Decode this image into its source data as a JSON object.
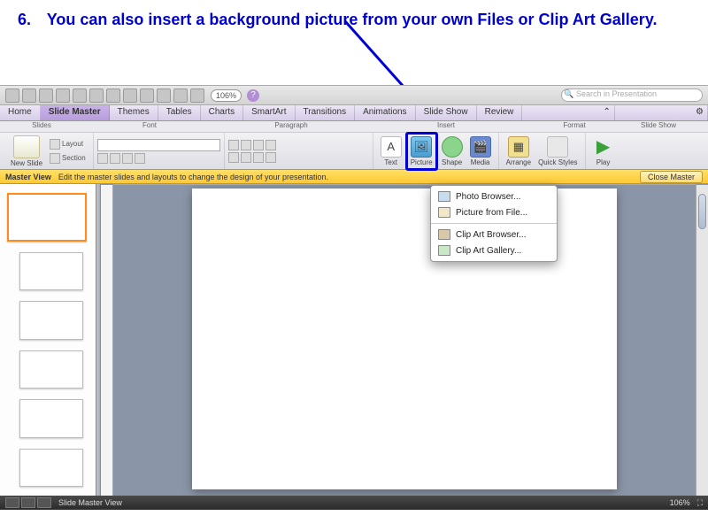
{
  "instruction": {
    "number": "6.",
    "text": "You can also insert a background picture from your own Files or Clip Art Gallery."
  },
  "qat": {
    "zoom": "106%",
    "search_placeholder": "Search in Presentation"
  },
  "tabs": {
    "items": [
      "Home",
      "Slide Master",
      "Themes",
      "Tables",
      "Charts",
      "SmartArt",
      "Transitions",
      "Animations",
      "Slide Show",
      "Review"
    ],
    "active_index": 1,
    "chevrons": "⌃"
  },
  "sections": {
    "slides": "Slides",
    "font": "Font",
    "paragraph": "Paragraph",
    "insert": "Insert",
    "format": "Format",
    "slideshow": "Slide Show"
  },
  "ribbon": {
    "new_slide": "New Slide",
    "layout": "Layout",
    "section": "Section",
    "text": "Text",
    "picture": "Picture",
    "shape": "Shape",
    "media": "Media",
    "arrange": "Arrange",
    "quick_styles": "Quick Styles",
    "play": "Play"
  },
  "master_bar": {
    "title": "Master View",
    "desc": "Edit the master slides and layouts to change the design of your presentation.",
    "close": "Close Master"
  },
  "dropdown": {
    "photo_browser": "Photo Browser...",
    "picture_from_file": "Picture from File...",
    "clip_art_browser": "Clip Art Browser...",
    "clip_art_gallery": "Clip Art Gallery..."
  },
  "status": {
    "view_label": "Slide Master View",
    "zoom": "106%"
  }
}
